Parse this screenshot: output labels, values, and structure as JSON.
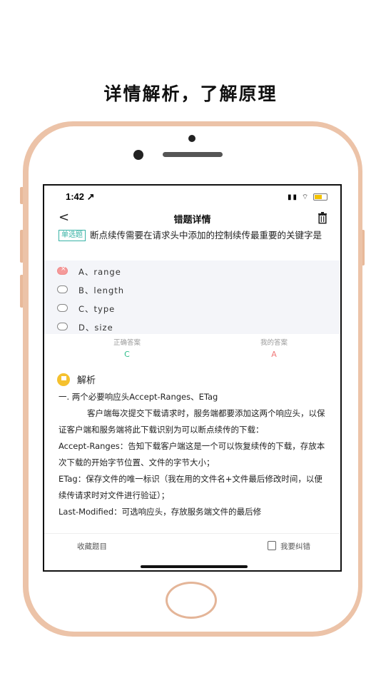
{
  "headline": "详情解析，了解原理",
  "status_bar": {
    "time": "1:42 ↗",
    "icons": "▮▮ ⌔"
  },
  "nav": {
    "back": "<",
    "title": "错题详情"
  },
  "question": {
    "tag": "单选题",
    "text": "断点续传需要在请求头中添加的控制续传最重要的关键字是"
  },
  "options": [
    {
      "label": "A、range",
      "state": "wrong"
    },
    {
      "label": "B、length",
      "state": "none"
    },
    {
      "label": "C、type",
      "state": "none"
    },
    {
      "label": "D、size",
      "state": "none"
    }
  ],
  "answers": {
    "correct_label": "正确答案",
    "correct_value": "C",
    "mine_label": "我的答案",
    "mine_value": "A",
    "correct_color": "#2ebd8a",
    "mine_color": "#f07a7a"
  },
  "analysis": {
    "title": "解析",
    "lines": [
      "一. 两个必要响应头Accept-Ranges、ETag",
      "客户端每次提交下载请求时，服务端都要添加这两个响应头，以保证客户端和服务端将此下载识别为可以断点续传的下载：",
      "Accept-Ranges：告知下载客户端这是一个可以恢复续传的下载，存放本次下载的开始字节位置、文件的字节大小；",
      "ETag：保存文件的唯一标识（我在用的文件名+文件最后修改时间，以便续传请求时对文件进行验证）；",
      "Last-Modified：可选响应头，存放服务端文件的最后修"
    ]
  },
  "bottom": {
    "collect": "收藏题目",
    "report": "我要纠错"
  }
}
